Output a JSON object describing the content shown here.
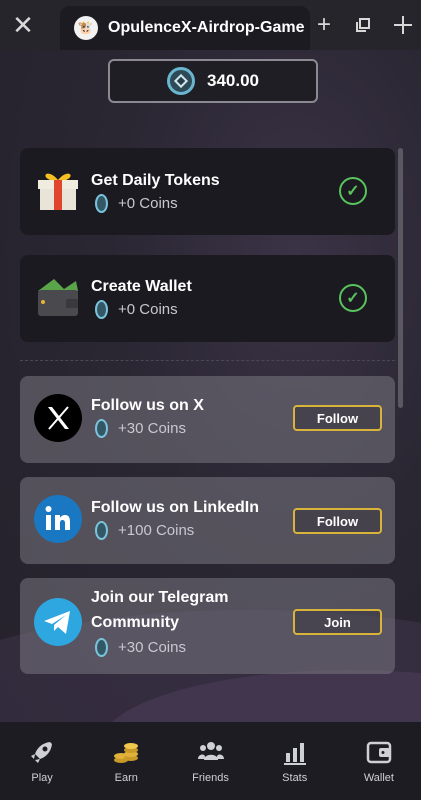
{
  "window": {
    "tab_title": "OpulenceX-Airdrop-Game",
    "close_glyph": "✕",
    "new_tab_glyph": "+",
    "restore_glyph": "⧉",
    "expand_glyph": "⤡"
  },
  "balance": {
    "value": "340.00",
    "icon": "coin-icon"
  },
  "tasks": [
    {
      "title": "Get Daily Tokens",
      "reward": "+0 Coins",
      "icon": "gift-icon",
      "status": "done"
    },
    {
      "title": "Create Wallet",
      "reward": "+0 Coins",
      "icon": "wallet-icon",
      "status": "done"
    },
    {
      "title": "Follow us on X",
      "reward": "+30 Coins",
      "icon": "x-logo-icon",
      "action": "Follow"
    },
    {
      "title": "Follow us on LinkedIn",
      "reward": "+100 Coins",
      "icon": "linkedin-logo-icon",
      "action": "Follow"
    },
    {
      "title_line1": "Join our Telegram",
      "title_line2": "Community",
      "reward": "+30 Coins",
      "icon": "telegram-logo-icon",
      "action": "Join"
    }
  ],
  "nav": [
    {
      "label": "Play",
      "icon": "rocket-icon"
    },
    {
      "label": "Earn",
      "icon": "coins-stack-icon",
      "active": true
    },
    {
      "label": "Friends",
      "icon": "friends-icon"
    },
    {
      "label": "Stats",
      "icon": "bar-chart-icon"
    },
    {
      "label": "Wallet",
      "icon": "wallet-nav-icon"
    }
  ],
  "colors": {
    "accent_gold": "#d9b43a",
    "check_green": "#59c35c",
    "coin_blue": "#79c3db"
  }
}
